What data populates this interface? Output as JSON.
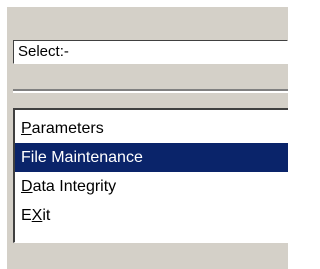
{
  "select_field": {
    "value": "Select:-"
  },
  "menu": {
    "items": [
      {
        "mnemonic": "P",
        "label_rest": "arameters",
        "selected": false
      },
      {
        "mnemonic": "",
        "label_rest": "File Maintenance",
        "selected": true
      },
      {
        "mnemonic": "D",
        "label_rest": "ata Integrity",
        "selected": false
      },
      {
        "label_pre": "E",
        "mnemonic": "X",
        "label_rest": "it",
        "selected": false
      }
    ]
  },
  "colors": {
    "panel_face": "#d4d0c8",
    "selection_highlight": "#0a246a",
    "selection_text": "#ffffff"
  }
}
